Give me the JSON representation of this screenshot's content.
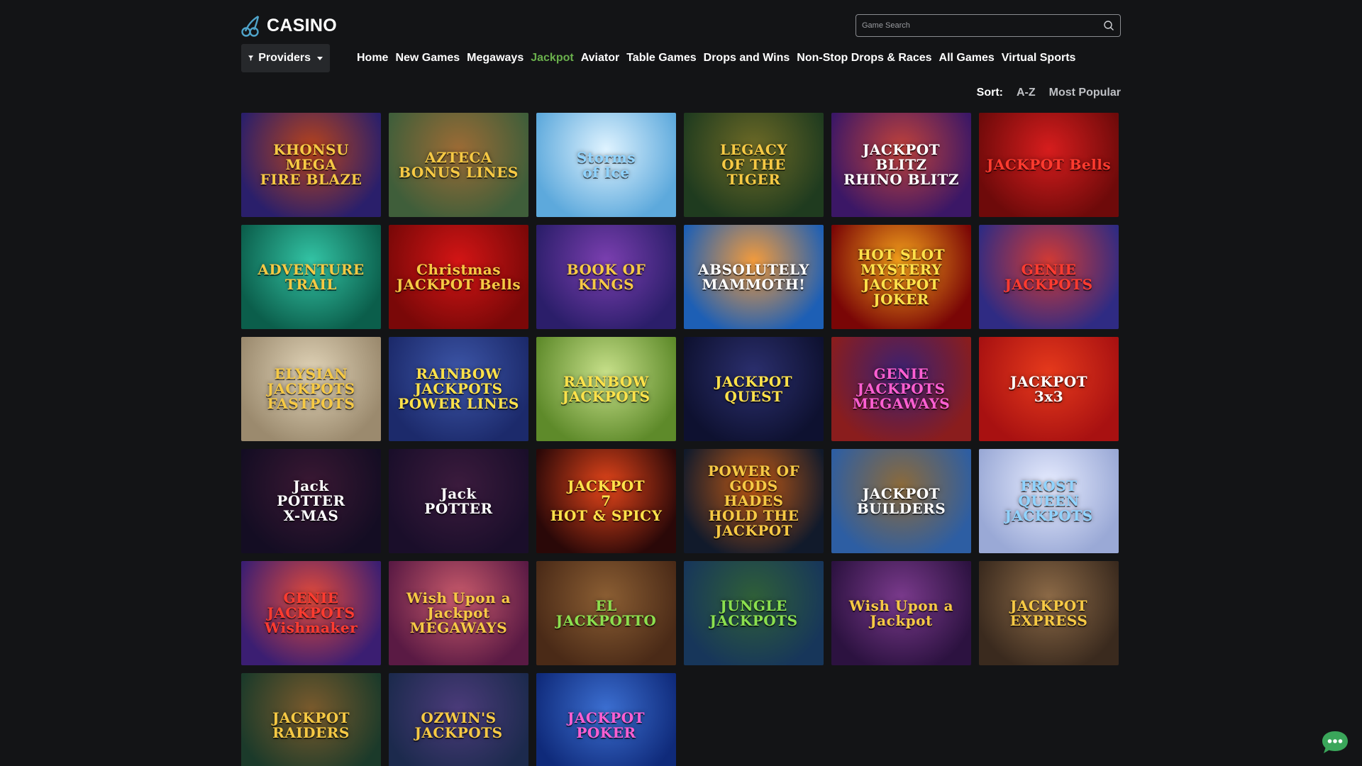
{
  "header": {
    "logo_text": "CASINO",
    "search": {
      "placeholder": "Game Search",
      "value": ""
    }
  },
  "nav": {
    "providers_label": "Providers",
    "items": [
      {
        "label": "Home",
        "active": false
      },
      {
        "label": "New Games",
        "active": false
      },
      {
        "label": "Megaways",
        "active": false
      },
      {
        "label": "Jackpot",
        "active": true
      },
      {
        "label": "Aviator",
        "active": false
      },
      {
        "label": "Table Games",
        "active": false
      },
      {
        "label": "Drops and Wins",
        "active": false
      },
      {
        "label": "Non-Stop Drops & Races",
        "active": false
      },
      {
        "label": "All Games",
        "active": false
      },
      {
        "label": "Virtual Sports",
        "active": false
      }
    ]
  },
  "sort": {
    "label": "Sort:",
    "options": [
      "A-Z",
      "Most Popular"
    ]
  },
  "colors": {
    "background": "#131416",
    "accent_active": "#6ab04c",
    "chat_bubble": "#3aa65a"
  },
  "games": [
    {
      "title": "KHONSU\nMEGA\nFIRE BLAZE",
      "bg": [
        "#2a1f6b",
        "#b8431b"
      ],
      "text": "gold"
    },
    {
      "title": "AZTECA\nBONUS LINES",
      "bg": [
        "#3f5e3a",
        "#9c6b35"
      ],
      "text": "gold"
    },
    {
      "title": "Storms\nof Ice",
      "bg": [
        "#5da9dc",
        "#dff3ff"
      ],
      "text": "blue"
    },
    {
      "title": "LEGACY\nOF THE\nTIGER",
      "bg": [
        "#1f3b1f",
        "#6e6a26"
      ],
      "text": "gold"
    },
    {
      "title": "JACKPOT BLITZ\nRHINO BLITZ",
      "bg": [
        "#3b1766",
        "#c1423a"
      ],
      "text": "white"
    },
    {
      "title": "JACKPOT Bells",
      "bg": [
        "#6e0a0a",
        "#d61d1d"
      ],
      "text": "red"
    },
    {
      "title": "ADVENTURE\nTRAIL",
      "bg": [
        "#0b5e4b",
        "#33c4a5"
      ],
      "text": "gold"
    },
    {
      "title": "Christmas\nJACKPOT Bells",
      "bg": [
        "#7a0808",
        "#d31515"
      ],
      "text": "gold"
    },
    {
      "title": "BOOK OF\nKINGS",
      "bg": [
        "#2b1e6a",
        "#7b3fb0"
      ],
      "text": "gold"
    },
    {
      "title": "ABSOLUTELY\nMAMMOTH!",
      "bg": [
        "#1d5fb5",
        "#f39b3c"
      ],
      "text": "white"
    },
    {
      "title": "HOT SLOT\nMYSTERY JACKPOT\nJOKER",
      "bg": [
        "#7a0606",
        "#f5a21b"
      ],
      "text": "yellow"
    },
    {
      "title": "GENIE\nJACKPOTS",
      "bg": [
        "#2f2b83",
        "#d23a34"
      ],
      "text": "red"
    },
    {
      "title": "ELYSIAN\nJACKPOTS\nFASTPOTS",
      "bg": [
        "#9b8a6e",
        "#e1d4b8"
      ],
      "text": "gold"
    },
    {
      "title": "RAINBOW\nJACKPOTS\nPOWER LINES",
      "bg": [
        "#1c2a6b",
        "#3d56a8"
      ],
      "text": "yellow"
    },
    {
      "title": "RAINBOW JACKPOTS",
      "bg": [
        "#5e8a2a",
        "#c7e08a"
      ],
      "text": "yellow"
    },
    {
      "title": "JACKPOT\nQUEST",
      "bg": [
        "#0e1130",
        "#2b2f6e"
      ],
      "text": "yellow"
    },
    {
      "title": "GENIE\nJACKPOTS\nMEGAWAYS",
      "bg": [
        "#8a1d1d",
        "#3a2173"
      ],
      "text": "pink"
    },
    {
      "title": "JACKPOT\n3x3",
      "bg": [
        "#a81111",
        "#e63a1c"
      ],
      "text": "white"
    },
    {
      "title": "Jack\nPOTTER\nX-MAS",
      "bg": [
        "#140d23",
        "#3a1833"
      ],
      "text": "white"
    },
    {
      "title": "Jack\nPOTTER",
      "bg": [
        "#1a0e2a",
        "#3b1b3d"
      ],
      "text": "white"
    },
    {
      "title": "JACKPOT\n7\nHOT & SPICY",
      "bg": [
        "#2a0808",
        "#e3451a"
      ],
      "text": "yellow"
    },
    {
      "title": "POWER OF GODS\nHADES\nHOLD THE JACKPOT",
      "bg": [
        "#111a2b",
        "#c35a14"
      ],
      "text": "gold"
    },
    {
      "title": "JACKPOT\nBUILDERS",
      "bg": [
        "#2d5ea3",
        "#8b6a3b"
      ],
      "text": "white"
    },
    {
      "title": "FROST\nQUEEN\nJACKPOTS",
      "bg": [
        "#9aa9d6",
        "#e7ecff"
      ],
      "text": "blue"
    },
    {
      "title": "GENIE\nJACKPOTS\nWishmaker",
      "bg": [
        "#3b1e72",
        "#e24a3a"
      ],
      "text": "red"
    },
    {
      "title": "Wish Upon a\nJackpot\nMEGAWAYS",
      "bg": [
        "#5a1a44",
        "#c85a6b"
      ],
      "text": "gold"
    },
    {
      "title": "EL\nJACKPOTTO",
      "bg": [
        "#4a2a17",
        "#8b5e33"
      ],
      "text": "green"
    },
    {
      "title": "JUNGLE\nJACKPOTS",
      "bg": [
        "#17365a",
        "#2f5f38"
      ],
      "text": "green"
    },
    {
      "title": "Wish Upon a\nJackpot",
      "bg": [
        "#2c1240",
        "#7a3a8c"
      ],
      "text": "gold"
    },
    {
      "title": "JACKPOT\nEXPRESS",
      "bg": [
        "#3a2a1e",
        "#8c6a47"
      ],
      "text": "gold"
    },
    {
      "title": "JACKPOT\nRAIDERS",
      "bg": [
        "#1b3a2a",
        "#7a5a2c"
      ],
      "text": "gold"
    },
    {
      "title": "OZWIN'S\nJACKPOTS",
      "bg": [
        "#1c2a4d",
        "#4b3b7a"
      ],
      "text": "gold"
    },
    {
      "title": "JACKPOT\nPOKER",
      "bg": [
        "#0f2a7a",
        "#3c6fd1"
      ],
      "text": "pink"
    }
  ]
}
